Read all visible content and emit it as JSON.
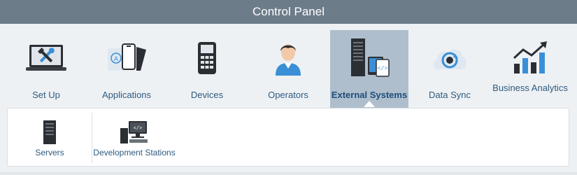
{
  "window": {
    "title": "Control Panel"
  },
  "nav": {
    "items": [
      {
        "label": "Set Up",
        "icon": "tools-laptop-icon"
      },
      {
        "label": "Applications",
        "icon": "mobile-apps-icon"
      },
      {
        "label": "Devices",
        "icon": "handheld-device-icon"
      },
      {
        "label": "Operators",
        "icon": "user-icon"
      },
      {
        "label": "External Systems",
        "icon": "server-code-icon",
        "active": true
      },
      {
        "label": "Data Sync",
        "icon": "cloud-sync-icon"
      },
      {
        "label": "Business Analytics",
        "icon": "bar-chart-trend-icon"
      }
    ]
  },
  "subnav": {
    "items": [
      {
        "label": "Servers",
        "icon": "server-icon"
      },
      {
        "label": "Development Stations",
        "icon": "dev-station-icon"
      }
    ]
  },
  "colors": {
    "titlebar": "#6d7c89",
    "label": "#2d5a7f",
    "active_bg": "#aebecc",
    "accent_blue": "#3a8fd6"
  }
}
